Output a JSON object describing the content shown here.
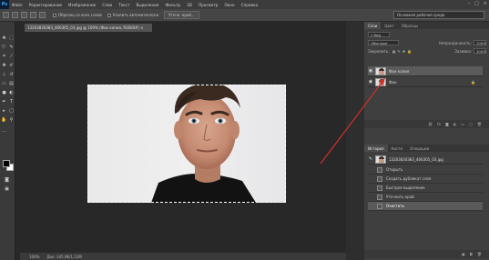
{
  "app": {
    "logo": "Ps"
  },
  "menu": [
    "Файл",
    "Редактирование",
    "Изображение",
    "Слои",
    "Текст",
    "Выделение",
    "Фильтр",
    "3D",
    "Просмотр",
    "Окно",
    "Справка"
  ],
  "options": {
    "sample_all_layers": "Образец со всех слоев",
    "auto_enhance": "Усилить автоматически",
    "refine_edge": "Уточн. край...",
    "workspace": "Основная рабочая среда"
  },
  "document": {
    "tab_title": "13203830383_466305_03.jpg @ 100% (Фон копия, RGB/8#) ×",
    "zoom": "100%",
    "doc_size": "Док: 345,9K/1,12M"
  },
  "layers_panel": {
    "tabs": [
      "Слои",
      "Цвет",
      "Образцы"
    ],
    "kind_label": "Вид",
    "blend_mode": "Обычные",
    "opacity_label": "Непрозрачность:",
    "opacity_value": "100%",
    "lock_label": "Закрепить:",
    "fill_label": "Заливка:",
    "fill_value": "100%",
    "layers": [
      {
        "name": "Фон копия",
        "selected": true
      },
      {
        "name": "Фон",
        "selected": false
      }
    ]
  },
  "history_panel": {
    "tabs": [
      "История",
      "Кисти",
      "Операции"
    ],
    "snapshot": "13203830383_466305_03.jpg",
    "items": [
      "Открыть",
      "Создать дубликат слоя",
      "Быстрое выделение",
      "Уточнить край",
      "Очистить"
    ]
  },
  "colors": {
    "foreground": "#000000",
    "background": "#ffffff",
    "arrow": "#d0302a"
  }
}
